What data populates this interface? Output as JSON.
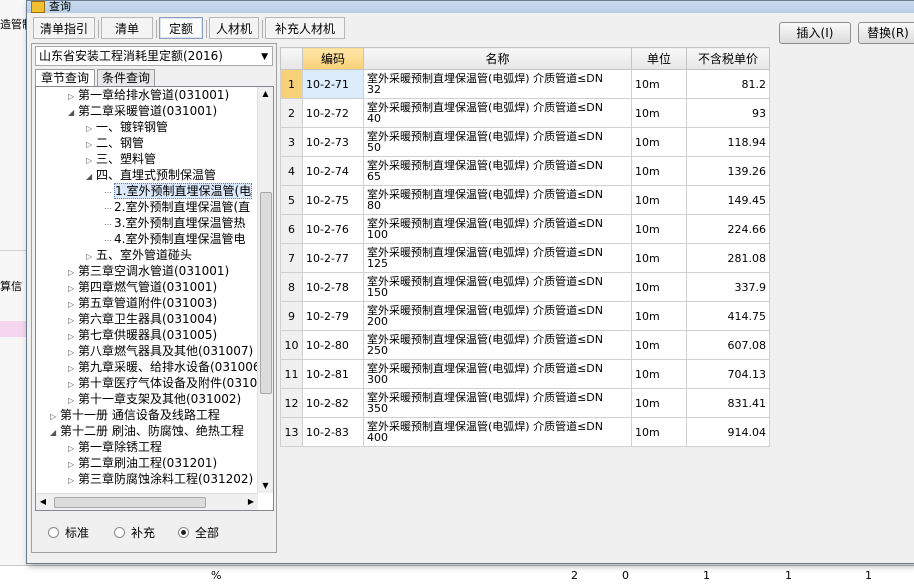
{
  "background": {
    "left_labels": [
      "造管制",
      "算信"
    ],
    "bottom_row": [
      "%",
      "2",
      "0",
      "1",
      "1",
      "1"
    ]
  },
  "window": {
    "title": "查询"
  },
  "tabs": [
    "清单指引",
    "清单",
    "定额",
    "人材机",
    "补充人材机"
  ],
  "active_tab": "定额",
  "buttons": {
    "insert": "插入(I)",
    "replace": "替换(R)"
  },
  "left": {
    "dropdown_value": "山东省安装工程消耗里定额(2016)",
    "subtabs": [
      "章节查询",
      "条件查询"
    ],
    "tree": [
      {
        "label": "第一章给排水管道(031001)",
        "indent": 1,
        "arrow": "closed"
      },
      {
        "label": "第二章采暖管道(031001)",
        "indent": 1,
        "arrow": "open"
      },
      {
        "label": "一、镀锌钢管",
        "indent": 2,
        "arrow": "closed"
      },
      {
        "label": "二、钢管",
        "indent": 2,
        "arrow": "closed"
      },
      {
        "label": "三、塑料管",
        "indent": 2,
        "arrow": "closed"
      },
      {
        "label": "四、直埋式预制保温管",
        "indent": 2,
        "arrow": "open"
      },
      {
        "label": "1.室外预制直埋保温管(电",
        "indent": 3,
        "arrow": "leaf",
        "selected": true
      },
      {
        "label": "2.室外预制直埋保温管(直",
        "indent": 3,
        "arrow": "leaf"
      },
      {
        "label": "3.室外预制直埋保温管热",
        "indent": 3,
        "arrow": "leaf"
      },
      {
        "label": "4.室外预制直埋保温管电",
        "indent": 3,
        "arrow": "leaf"
      },
      {
        "label": "五、室外管道碰头",
        "indent": 2,
        "arrow": "closed"
      },
      {
        "label": "第三章空调水管道(031001)",
        "indent": 1,
        "arrow": "closed"
      },
      {
        "label": "第四章燃气管道(031001)",
        "indent": 1,
        "arrow": "closed"
      },
      {
        "label": "第五章管道附件(031003)",
        "indent": 1,
        "arrow": "closed"
      },
      {
        "label": "第六章卫生器具(031004)",
        "indent": 1,
        "arrow": "closed"
      },
      {
        "label": "第七章供暖器具(031005)",
        "indent": 1,
        "arrow": "closed"
      },
      {
        "label": "第八章燃气器具及其他(031007)",
        "indent": 1,
        "arrow": "closed"
      },
      {
        "label": "第九章采暖、给排水设备(031006",
        "indent": 1,
        "arrow": "closed"
      },
      {
        "label": "第十章医疗气体设备及附件(0310",
        "indent": 1,
        "arrow": "closed"
      },
      {
        "label": "第十一章支架及其他(031002)",
        "indent": 1,
        "arrow": "closed"
      },
      {
        "label": "第十一册 通信设备及线路工程",
        "indent": 0,
        "arrow": "closed"
      },
      {
        "label": "第十二册 刷油、防腐蚀、绝热工程",
        "indent": 0,
        "arrow": "open"
      },
      {
        "label": "第一章除锈工程",
        "indent": 1,
        "arrow": "closed"
      },
      {
        "label": "第二章刷油工程(031201)",
        "indent": 1,
        "arrow": "closed"
      },
      {
        "label": "第三章防腐蚀涂料工程(031202)",
        "indent": 1,
        "arrow": "closed"
      }
    ],
    "radios": [
      "标准",
      "补充",
      "全部"
    ],
    "radio_selected": "全部"
  },
  "grid": {
    "headers": [
      "编码",
      "名称",
      "单位",
      "不含税单价"
    ],
    "rows": [
      {
        "n": "1",
        "code": "10-2-71",
        "name1": "室外采暖预制直埋保温管(电弧焊) 介质管道≤DN",
        "name2": "32",
        "unit": "10m",
        "price": "81.2"
      },
      {
        "n": "2",
        "code": "10-2-72",
        "name1": "室外采暖预制直埋保温管(电弧焊) 介质管道≤DN",
        "name2": "40",
        "unit": "10m",
        "price": "93"
      },
      {
        "n": "3",
        "code": "10-2-73",
        "name1": "室外采暖预制直埋保温管(电弧焊) 介质管道≤DN",
        "name2": "50",
        "unit": "10m",
        "price": "118.94"
      },
      {
        "n": "4",
        "code": "10-2-74",
        "name1": "室外采暖预制直埋保温管(电弧焊) 介质管道≤DN",
        "name2": "65",
        "unit": "10m",
        "price": "139.26"
      },
      {
        "n": "5",
        "code": "10-2-75",
        "name1": "室外采暖预制直埋保温管(电弧焊) 介质管道≤DN",
        "name2": "80",
        "unit": "10m",
        "price": "149.45"
      },
      {
        "n": "6",
        "code": "10-2-76",
        "name1": "室外采暖预制直埋保温管(电弧焊) 介质管道≤DN",
        "name2": "100",
        "unit": "10m",
        "price": "224.66"
      },
      {
        "n": "7",
        "code": "10-2-77",
        "name1": "室外采暖预制直埋保温管(电弧焊) 介质管道≤DN",
        "name2": "125",
        "unit": "10m",
        "price": "281.08"
      },
      {
        "n": "8",
        "code": "10-2-78",
        "name1": "室外采暖预制直埋保温管(电弧焊) 介质管道≤DN",
        "name2": "150",
        "unit": "10m",
        "price": "337.9"
      },
      {
        "n": "9",
        "code": "10-2-79",
        "name1": "室外采暖预制直埋保温管(电弧焊) 介质管道≤DN",
        "name2": "200",
        "unit": "10m",
        "price": "414.75"
      },
      {
        "n": "10",
        "code": "10-2-80",
        "name1": "室外采暖预制直埋保温管(电弧焊) 介质管道≤DN",
        "name2": "250",
        "unit": "10m",
        "price": "607.08"
      },
      {
        "n": "11",
        "code": "10-2-81",
        "name1": "室外采暖预制直埋保温管(电弧焊) 介质管道≤DN",
        "name2": "300",
        "unit": "10m",
        "price": "704.13"
      },
      {
        "n": "12",
        "code": "10-2-82",
        "name1": "室外采暖预制直埋保温管(电弧焊) 介质管道≤DN",
        "name2": "350",
        "unit": "10m",
        "price": "831.41"
      },
      {
        "n": "13",
        "code": "10-2-83",
        "name1": "室外采暖预制直埋保温管(电弧焊) 介质管道≤DN",
        "name2": "400",
        "unit": "10m",
        "price": "914.04"
      }
    ]
  }
}
